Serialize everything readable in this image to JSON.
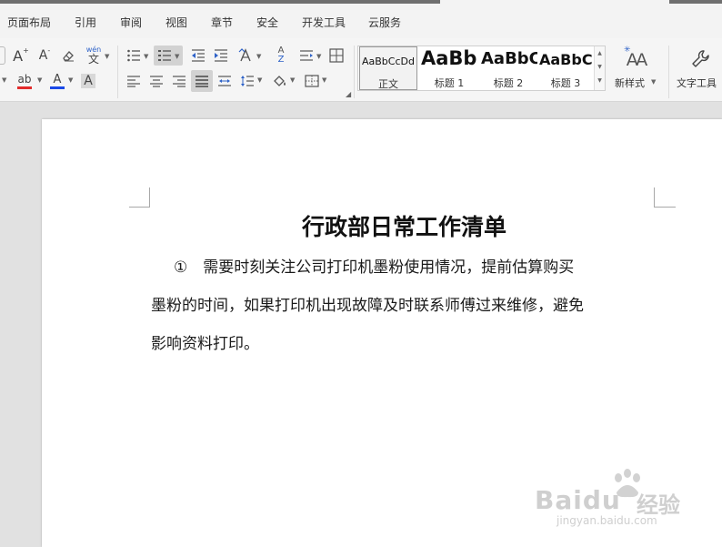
{
  "menu": {
    "items": [
      "页面布局",
      "引用",
      "审阅",
      "视图",
      "章节",
      "安全",
      "开发工具",
      "云服务"
    ]
  },
  "ribbon": {
    "font_tools": {
      "grow_font_glyph": "A",
      "shrink_font_glyph": "A",
      "phonetic_top": "wén",
      "phonetic_bottom": "文",
      "highlight_glyph": "ab",
      "font_color_glyph": "A",
      "char_shade_glyph": "A",
      "highlight_color": "#e22b2b",
      "font_color": "#1a49e8"
    },
    "paragraph_tools": {
      "sort_glyph_top": "A",
      "sort_glyph_bottom": "Z"
    },
    "styles": [
      {
        "sample": "AaBbCcDd",
        "name": "正文"
      },
      {
        "sample": "AaBb",
        "name": "标题 1"
      },
      {
        "sample": "AaBbC",
        "name": "标题 2"
      },
      {
        "sample": "AaBbC",
        "name": "标题 3"
      }
    ],
    "new_style_label": "新样式",
    "new_style_glyph": "AA",
    "text_tools_label": "文字工具"
  },
  "document": {
    "title": "行政部日常工作清单",
    "lines": [
      "①　需要时刻关注公司打印机墨粉使用情况，提前估算购买",
      "墨粉的时间，如果打印机出现故障及时联系师傅过来维修，避免",
      "影响资料打印。"
    ]
  },
  "watermark": {
    "brand": "Baidu",
    "cn": "经验",
    "url": "jingyan.baidu.com"
  }
}
